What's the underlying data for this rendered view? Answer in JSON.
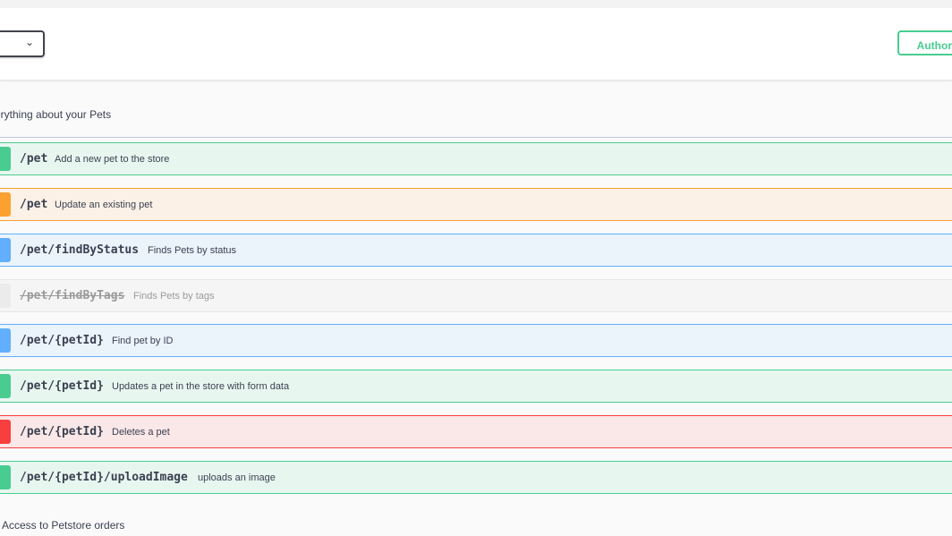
{
  "header": {
    "authorize_label": "Authoriz",
    "scheme_select": {
      "icon": "chevron-down-icon",
      "glyph": "⌄"
    }
  },
  "tag": {
    "description": "erything about your Pets"
  },
  "operations": [
    {
      "method": "post",
      "path": "/pet",
      "summary": "Add a new pet to the store"
    },
    {
      "method": "put",
      "path": "/pet",
      "summary": "Update an existing pet"
    },
    {
      "method": "get",
      "path": "/pet/findByStatus",
      "summary": "Finds Pets by status"
    },
    {
      "method": "get",
      "path": "/pet/findByTags",
      "summary": "Finds Pets by tags",
      "deprecated": true
    },
    {
      "method": "get",
      "path": "/pet/{petId}",
      "summary": "Find pet by ID"
    },
    {
      "method": "post",
      "path": "/pet/{petId}",
      "summary": "Updates a pet in the store with form data"
    },
    {
      "method": "delete",
      "path": "/pet/{petId}",
      "summary": "Deletes a pet"
    },
    {
      "method": "post",
      "path": "/pet/{petId}/uploadImage",
      "summary": "uploads an image"
    }
  ],
  "next_tag": {
    "description": "Access to Petstore orders"
  },
  "colors": {
    "post": "#49cc90",
    "put": "#fca130",
    "get": "#61affe",
    "delete": "#f93e3e",
    "text": "#3b4151"
  }
}
